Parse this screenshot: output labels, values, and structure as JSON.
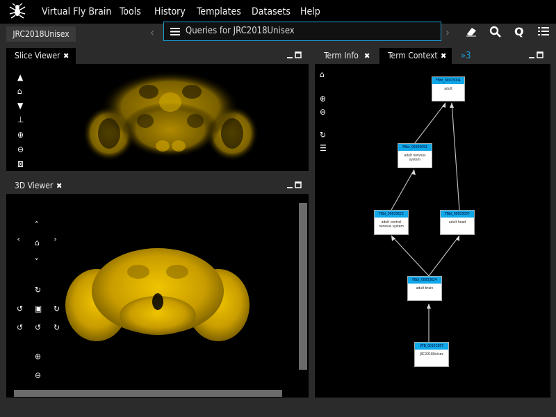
{
  "menubar": {
    "items": [
      "Virtual Fly Brain",
      "Tools",
      "History",
      "Templates",
      "Datasets",
      "Help"
    ]
  },
  "template_tab": "JRC2018Unisex",
  "query_bar": {
    "text": "Queries for JRC2018Unisex"
  },
  "panels": {
    "slice_viewer": {
      "title": "Slice Viewer"
    },
    "viewer_3d": {
      "title": "3D Viewer"
    },
    "term_info": {
      "title": "Term Info"
    },
    "term_context": {
      "title": "Term Context"
    },
    "overflow_tab": "»3"
  },
  "graph": {
    "nodes": [
      {
        "id": "FBbt_00003004",
        "label": "adult"
      },
      {
        "id": "FBbt_00005093",
        "label": "adult nervous system"
      },
      {
        "id": "FBbt_00003623",
        "label": "adult central nervous system"
      },
      {
        "id": "FBbt_00003007",
        "label": "adult head"
      },
      {
        "id": "FBbt_00003624",
        "label": "adult brain"
      },
      {
        "id": "VFB_00101567",
        "label": "JRC2018Unisex"
      }
    ]
  },
  "colors": {
    "accent": "#1b9fd8",
    "node_header": "#10a8e8",
    "brain": "#d4a800"
  }
}
